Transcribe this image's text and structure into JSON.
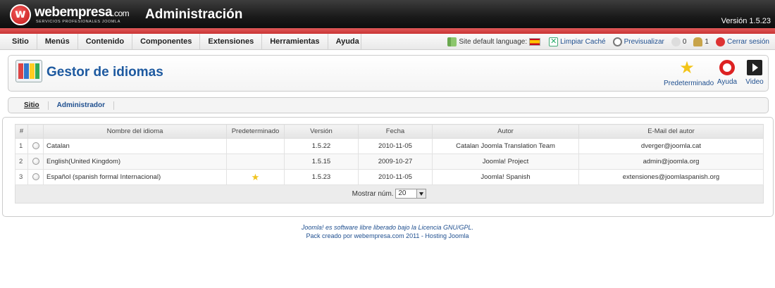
{
  "header": {
    "logo_main": "webempresa",
    "logo_tld": ".com",
    "logo_sub": "SERVICIOS PROFESIONALES JOOMLA",
    "app_title": "Administración",
    "version": "Versión 1.5.23"
  },
  "menu": {
    "items": [
      "Sitio",
      "Menús",
      "Contenido",
      "Componentes",
      "Extensiones",
      "Herramientas",
      "Ayuda"
    ]
  },
  "status": {
    "lang_label": "Site default language:",
    "clear_cache": "Limpiar Caché",
    "preview": "Previsualizar",
    "messages": "0",
    "users": "1",
    "logout": "Cerrar sesión"
  },
  "toolbar": {
    "title": "Gestor de idiomas",
    "default_label": "Predeterminado",
    "help_label": "Ayuda",
    "video_label": "Video"
  },
  "submenu": {
    "items": [
      "Sitio",
      "Administrador"
    ]
  },
  "table": {
    "headers": [
      "#",
      "Nombre del idioma",
      "Predeterminado",
      "Versión",
      "Fecha",
      "Autor",
      "E-Mail del autor"
    ],
    "rows": [
      {
        "num": "1",
        "name": "Catalan",
        "default": false,
        "version": "1.5.22",
        "date": "2010-11-05",
        "author": "Catalan Joomla Translation Team",
        "email": "dverger@joomla.cat"
      },
      {
        "num": "2",
        "name": "English(United Kingdom)",
        "default": false,
        "version": "1.5.15",
        "date": "2009-10-27",
        "author": "Joomla! Project",
        "email": "admin@joomla.org"
      },
      {
        "num": "3",
        "name": "Español (spanish formal Internacional)",
        "default": true,
        "version": "1.5.23",
        "date": "2010-11-05",
        "author": "Joomla! Spanish",
        "email": "extensiones@joomlaspanish.org"
      }
    ],
    "limit_label": "Mostrar núm.",
    "limit_value": "20"
  },
  "footer": {
    "joomla_link": "Joomla!",
    "text_1": " es software libre liberado bajo la ",
    "license_link": "Licencia GNU/GPL",
    "text_2": ".",
    "line2": "Pack creado por webempresa.com 2011 - Hosting Joomla"
  },
  "colors": {
    "header_bg": "#1a1a1a",
    "header_stripe": "#c93434",
    "title_blue": "#1e5aa0",
    "link_blue": "#1f4f8f"
  }
}
